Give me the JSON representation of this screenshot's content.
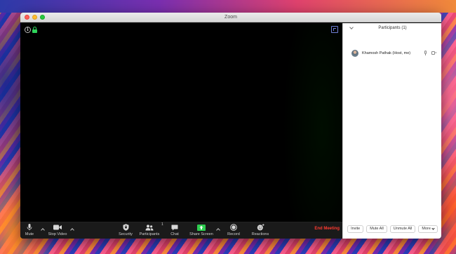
{
  "window": {
    "title": "Zoom"
  },
  "toolbar": {
    "mute_label": "Mute",
    "stop_video_label": "Stop Video",
    "security_label": "Security",
    "participants_label": "Participants",
    "participants_count": "1",
    "chat_label": "Chat",
    "share_screen_label": "Share Screen",
    "record_label": "Record",
    "reactions_label": "Reactions",
    "end_meeting_label": "End Meeting"
  },
  "panel": {
    "title": "Participants (1)",
    "participants": [
      {
        "name": "Khamosh Pathak (Host, me)"
      }
    ],
    "buttons": {
      "invite": "Invite",
      "mute_all": "Mute All",
      "unmute_all": "Unmute All",
      "more": "More"
    }
  },
  "colors": {
    "end_meeting": "#ff3b30",
    "share_screen": "#2ecc4f",
    "lock": "#2fd35a",
    "toolbar_bg": "#1a1a1a"
  }
}
